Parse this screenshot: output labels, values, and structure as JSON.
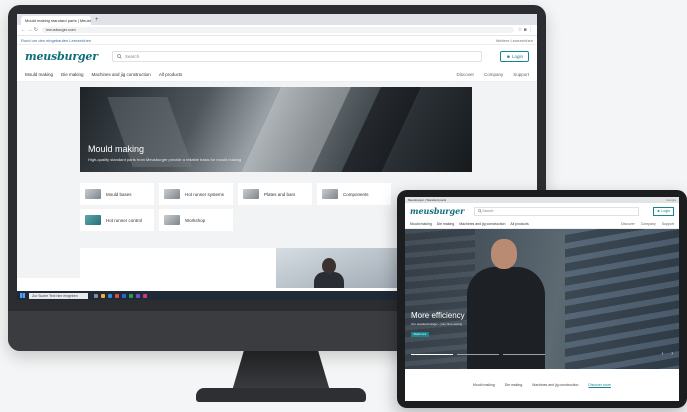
{
  "browser": {
    "tab_title": "Mould making standard parts | Meusburger",
    "tab_new": "+",
    "url": "meusburger.com",
    "bookmark_label": "Rund um den eingebauten Leerzeichen",
    "bookmark_right": "Weitere Lesezeichen"
  },
  "site": {
    "logo": "meusburger",
    "search_placeholder": "Search",
    "login_label": "Login",
    "nav_left": [
      "Mould making",
      "Die making",
      "Machines and jig construction",
      "All products"
    ],
    "nav_right": [
      "Discover",
      "Company",
      "Support"
    ]
  },
  "hero": {
    "title": "Mould making",
    "subtitle": "High-quality standard parts from Meusburger provide a reliable basis for mould making"
  },
  "categories": [
    {
      "label": "Mould bases"
    },
    {
      "label": "Hot runner systems"
    },
    {
      "label": "Plates and bars"
    },
    {
      "label": "Components"
    },
    {
      "label": "Hot runner control"
    },
    {
      "label": "Workshop"
    }
  ],
  "taskbar": {
    "search_placeholder": "Zur Suche Text hier eingeben"
  },
  "tablet": {
    "tab_title": "Meusburger | Standard parts",
    "tab_right": "Google",
    "logo": "meusburger",
    "search_placeholder": "Search",
    "login_label": "Login",
    "nav_left": [
      "Mould making",
      "Die making",
      "Machines and jig construction",
      "All products"
    ],
    "nav_right": [
      "Discover",
      "Company",
      "Support"
    ],
    "hero_title": "More efficiency",
    "hero_subtitle": "Our standard range – your time saving",
    "hero_button": "Read more",
    "footer_tabs": [
      "Mould making",
      "Die making",
      "Machines and jig construction",
      "Discover more"
    ],
    "active_tab_index": 3
  },
  "colors": {
    "brand": "#0e6f7a",
    "accent": "#19858f",
    "bezel": "#2b2d30"
  }
}
